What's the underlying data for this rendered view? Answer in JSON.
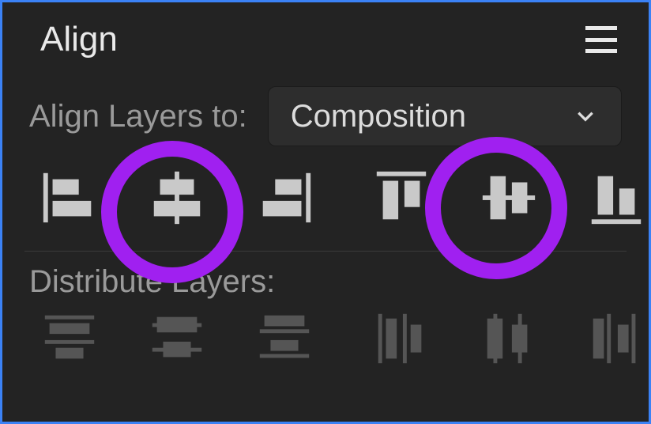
{
  "panel": {
    "title": "Align",
    "menu_tooltip": "Panel Menu"
  },
  "align_section": {
    "label": "Align Layers to:",
    "dropdown": {
      "selected": "Composition"
    },
    "buttons": [
      {
        "name": "align-left"
      },
      {
        "name": "align-horizontal-center"
      },
      {
        "name": "align-right"
      },
      {
        "name": "align-top"
      },
      {
        "name": "align-vertical-center"
      },
      {
        "name": "align-bottom"
      }
    ]
  },
  "distribute_section": {
    "label": "Distribute Layers:",
    "buttons": [
      {
        "name": "distribute-top"
      },
      {
        "name": "distribute-vertical-center"
      },
      {
        "name": "distribute-bottom"
      },
      {
        "name": "distribute-left"
      },
      {
        "name": "distribute-horizontal-center"
      },
      {
        "name": "distribute-right"
      }
    ]
  },
  "colors": {
    "highlight": "#A020F0",
    "icon_fill": "#c9c9c9"
  },
  "annotations": {
    "highlighted_buttons": [
      "align-horizontal-center",
      "align-vertical-center"
    ]
  }
}
